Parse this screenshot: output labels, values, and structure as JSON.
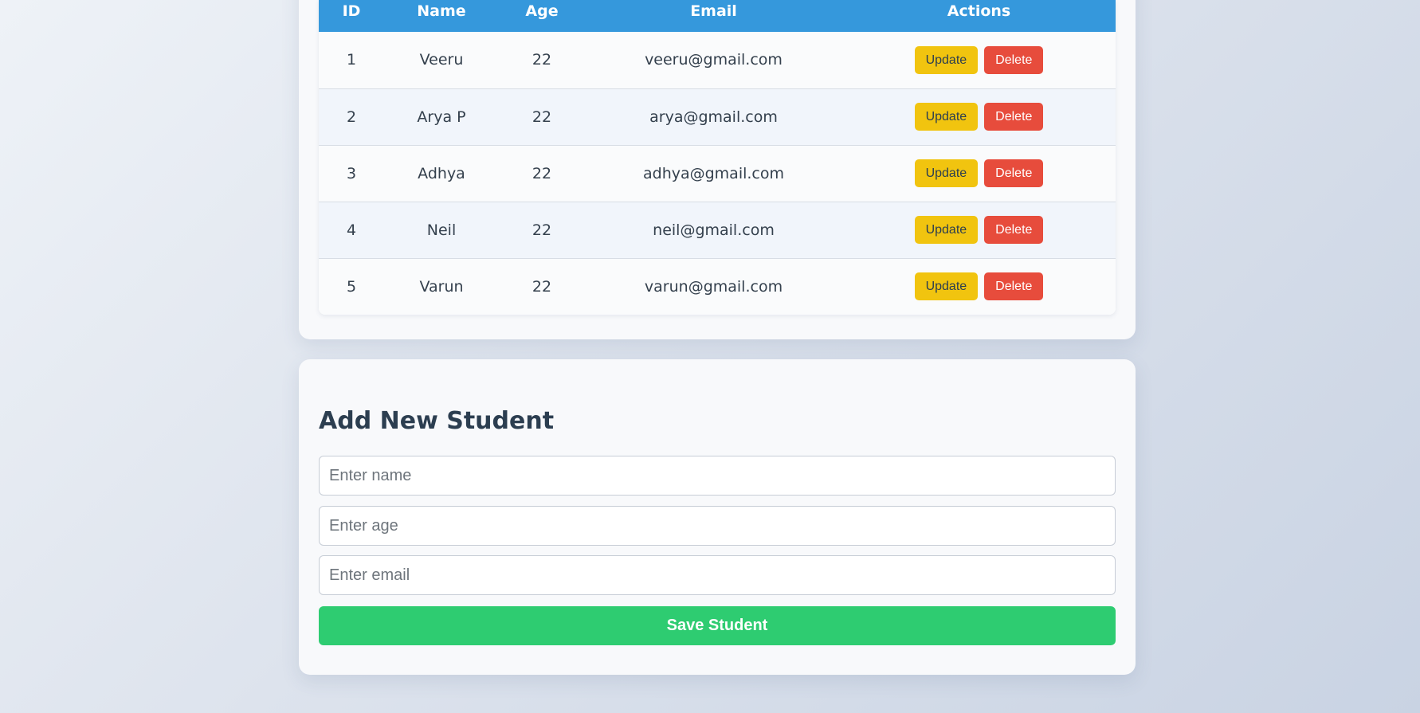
{
  "table": {
    "columns": [
      "ID",
      "Name",
      "Age",
      "Email",
      "Actions"
    ],
    "rows": [
      {
        "id": "1",
        "name": "Veeru",
        "age": "22",
        "email": "veeru@gmail.com"
      },
      {
        "id": "2",
        "name": "Arya P",
        "age": "22",
        "email": "arya@gmail.com"
      },
      {
        "id": "3",
        "name": "Adhya",
        "age": "22",
        "email": "adhya@gmail.com"
      },
      {
        "id": "4",
        "name": "Neil",
        "age": "22",
        "email": "neil@gmail.com"
      },
      {
        "id": "5",
        "name": "Varun",
        "age": "22",
        "email": "varun@gmail.com"
      }
    ],
    "update_label": "Update",
    "delete_label": "Delete"
  },
  "form": {
    "title": "Add New Student",
    "name_placeholder": "Enter name",
    "age_placeholder": "Enter age",
    "email_placeholder": "Enter email",
    "save_label": "Save Student"
  },
  "colors": {
    "header_blue": "#3598dc",
    "update_yellow": "#f1c40f",
    "delete_red": "#e74c3c",
    "save_green": "#2ecc71"
  }
}
